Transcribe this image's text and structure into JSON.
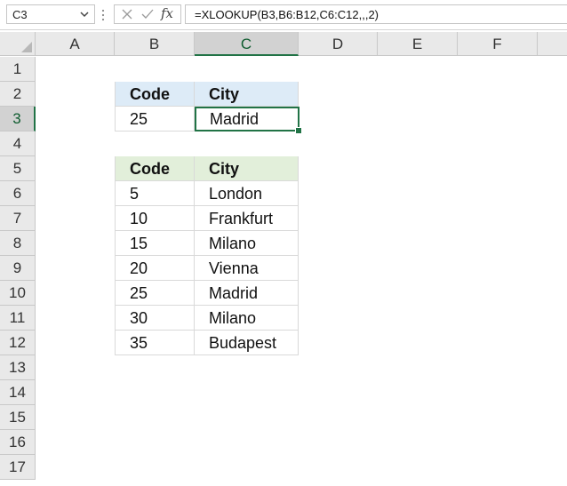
{
  "formula_bar": {
    "name_box": "C3",
    "formula": "=XLOOKUP(B3,B6:B12,C6:C12,,,2)",
    "fx_label": "fx"
  },
  "columns": [
    "A",
    "B",
    "C",
    "D",
    "E",
    "F"
  ],
  "selected_column": "C",
  "rows": [
    "1",
    "2",
    "3",
    "4",
    "5",
    "6",
    "7",
    "8",
    "9",
    "10",
    "11",
    "12",
    "13",
    "14",
    "15",
    "16",
    "17"
  ],
  "selected_row": "3",
  "lookup_table": {
    "headers": [
      "Code",
      "City"
    ],
    "row": [
      "25",
      "Madrid"
    ]
  },
  "data_table": {
    "headers": [
      "Code",
      "City"
    ],
    "rows": [
      [
        "5",
        "London"
      ],
      [
        "10",
        "Frankfurt"
      ],
      [
        "15",
        "Milano"
      ],
      [
        "20",
        "Vienna"
      ],
      [
        "25",
        "Madrid"
      ],
      [
        "30",
        "Milano"
      ],
      [
        "35",
        "Budapest"
      ]
    ]
  },
  "colors": {
    "accent": "#217346",
    "header_blue": "#ddebf7",
    "header_green": "#e2efda"
  }
}
